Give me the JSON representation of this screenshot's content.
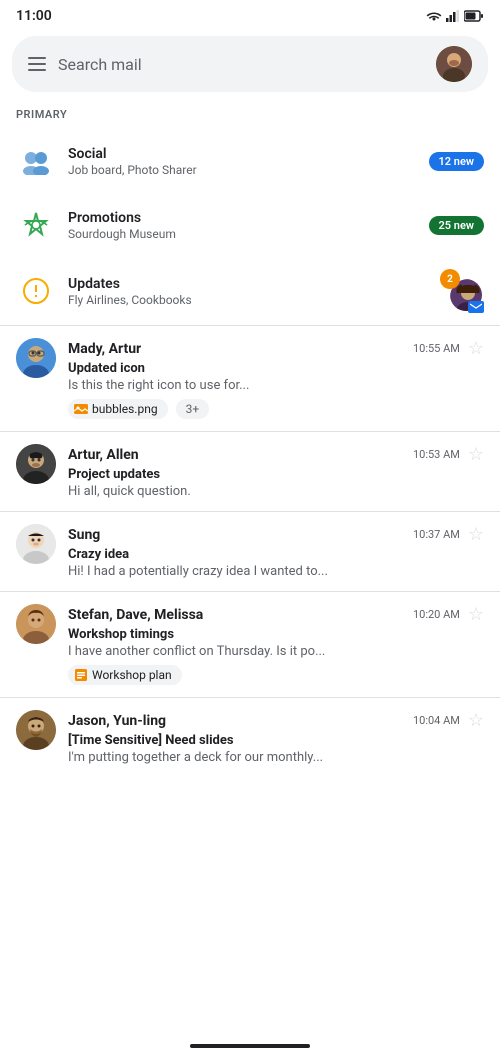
{
  "statusBar": {
    "time": "11:00"
  },
  "searchBar": {
    "placeholder": "Search mail"
  },
  "sectionLabel": "PRIMARY",
  "categories": [
    {
      "id": "social",
      "name": "Social",
      "subtitle": "Job board, Photo Sharer",
      "badge": "12 new",
      "badgeType": "blue"
    },
    {
      "id": "promotions",
      "name": "Promotions",
      "subtitle": "Sourdough Museum",
      "badge": "25 new",
      "badgeType": "green"
    },
    {
      "id": "updates",
      "name": "Updates",
      "subtitle": "Fly Airlines, Cookbooks",
      "badge": "2",
      "badgeType": "orange-avatar"
    }
  ],
  "emails": [
    {
      "id": "email-1",
      "sender": "Mady, Artur",
      "time": "10:55 AM",
      "subject": "Updated icon",
      "preview": "Is this the right icon to use for...",
      "avatarClass": "av-mady",
      "starred": false,
      "attachments": [
        "bubbles.png"
      ],
      "moreCount": "3+"
    },
    {
      "id": "email-2",
      "sender": "Artur, Allen",
      "time": "10:53 AM",
      "subject": "Project updates",
      "preview": "Hi all, quick question.",
      "avatarClass": "av-artur",
      "starred": false,
      "attachments": [],
      "moreCount": ""
    },
    {
      "id": "email-3",
      "sender": "Sung",
      "time": "10:37 AM",
      "subject": "Crazy idea",
      "preview": "Hi! I had a potentially crazy idea I wanted to...",
      "avatarClass": "av-sung",
      "starred": false,
      "attachments": [],
      "moreCount": ""
    },
    {
      "id": "email-4",
      "sender": "Stefan, Dave, Melissa",
      "time": "10:20 AM",
      "subject": "Workshop timings",
      "preview": "I have another conflict on Thursday. Is it po...",
      "avatarClass": "av-stefan",
      "starred": false,
      "attachments": [
        "Workshop plan"
      ],
      "moreCount": ""
    },
    {
      "id": "email-5",
      "sender": "Jason, Yun-ling",
      "time": "10:04 AM",
      "subject": "[Time Sensitive] Need slides",
      "preview": "I'm putting together a deck for our monthly...",
      "avatarClass": "av-jason",
      "starred": false,
      "attachments": [],
      "moreCount": ""
    }
  ]
}
